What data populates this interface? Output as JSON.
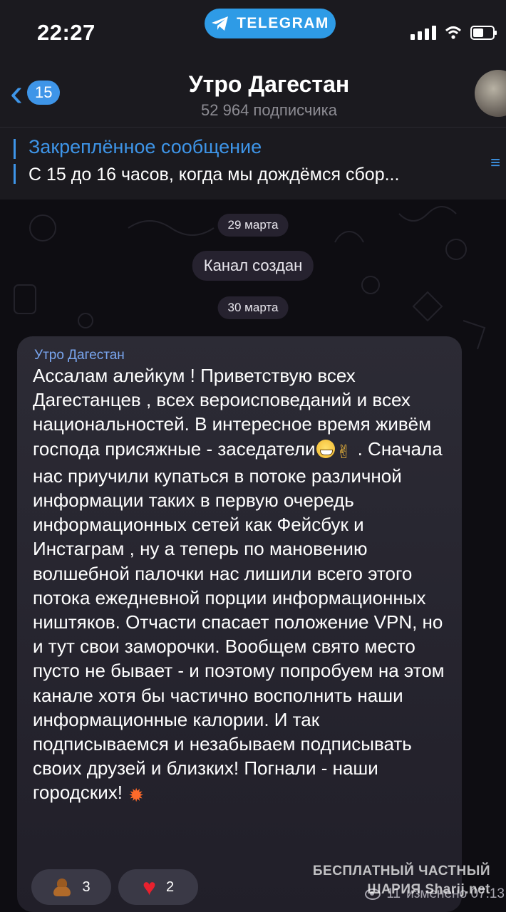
{
  "status_bar": {
    "time": "22:27",
    "app_pill": "TELEGRAM"
  },
  "header": {
    "back_count": "15",
    "channel_name": "Утро Дагестан",
    "subscribers": "52 964 подписчика"
  },
  "pinned": {
    "title": "Закреплённое сообщение",
    "text": "С 15 до 16 часов, когда мы дождёмся сбор..."
  },
  "chat": {
    "dates": [
      "29 марта",
      "30 марта"
    ],
    "service_message": "Канал создан",
    "message": {
      "author": "Утро Дагестан",
      "text_before_emoji": "Ассалам алейкум ! Приветствую всех Дагестанцев , всех вероисповеданий и всех национальностей. В интересное время живём господа присяжные - заседатели",
      "text_after_emoji": " . Сначала нас приучили купаться в потоке различной информации таких в первую очередь информационных сетей как Фейсбук и Инстаграм , ну а теперь по мановению волшебной палочки нас лишили всего этого потока ежедневной порции информационных ништяков. Отчасти спасает положение VPN, но и тут свои заморочки. Вообщем свято место пусто не бывает - и поэтому попробуем на этом канале хотя бы частично восполнить наши информационные калории. И так подписываемся и незабываем подписывать своих друзей и близких! Погнали - наши городских! ",
      "reactions": [
        {
          "icon": "poop-emoji",
          "count": "3"
        },
        {
          "icon": "heart-emoji",
          "count": "2"
        }
      ],
      "views": "11",
      "edited_time": "изменено 07:13"
    }
  },
  "watermark": {
    "line1": "БЕСПЛАТНЫЙ ЧАСТНЫЙ",
    "line2": "ШАРИЯ Sharij.net"
  },
  "colors": {
    "accent": "#3e95e8",
    "bubble": "#2a2933",
    "background": "#0e0d12"
  }
}
